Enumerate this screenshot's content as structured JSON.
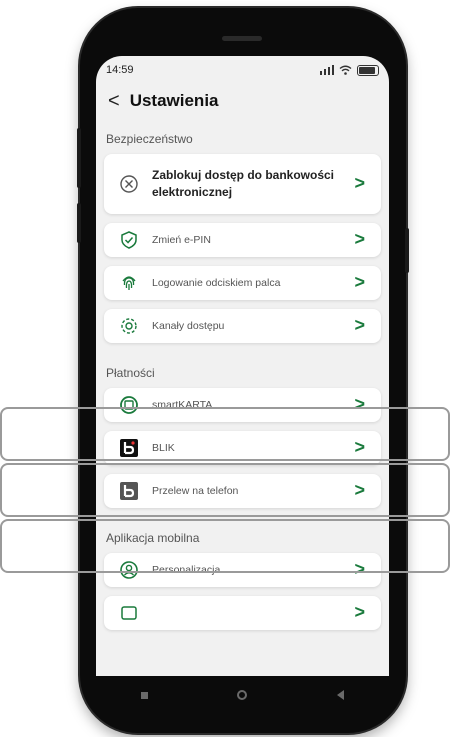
{
  "statusbar": {
    "time": "14:59"
  },
  "header": {
    "back_label": "<",
    "title": "Ustawienia"
  },
  "sections": {
    "security": {
      "title": "Bezpieczeństwo",
      "items": [
        {
          "label": "Zablokuj dostęp do bankowości elektronicznej",
          "icon": "block-icon"
        },
        {
          "label": "Zmień e-PIN",
          "icon": "shield-check-icon"
        },
        {
          "label": "Logowanie odciskiem palca",
          "icon": "fingerprint-icon"
        },
        {
          "label": "Kanały dostępu",
          "icon": "gear-icon"
        }
      ]
    },
    "payments": {
      "title": "Płatności",
      "items": [
        {
          "label": "smartKARTA",
          "icon": "smartkarta-icon"
        },
        {
          "label": "BLIK",
          "icon": "blik-icon"
        },
        {
          "label": "Przelew na telefon",
          "icon": "blik-icon"
        }
      ]
    },
    "mobile": {
      "title": "Aplikacja mobilna",
      "items": [
        {
          "label": "Personalizacja",
          "icon": "personalization-icon"
        },
        {
          "label": "",
          "icon": "device-icon"
        }
      ]
    }
  },
  "chevron": ">",
  "colors": {
    "accent": "#1a7a3c",
    "background": "#f1f1f1",
    "card": "#ffffff"
  }
}
